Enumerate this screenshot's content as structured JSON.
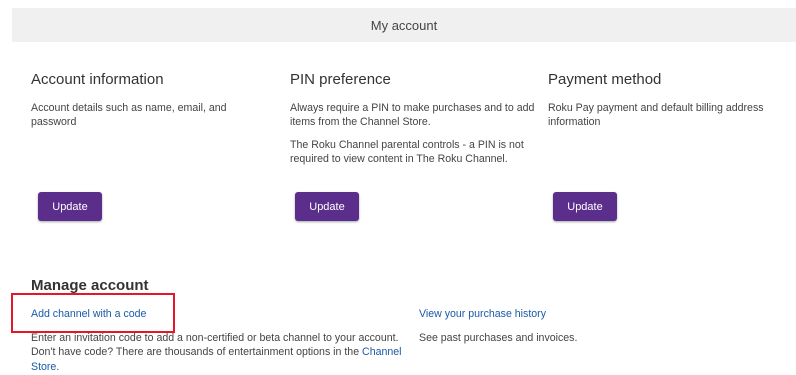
{
  "header": {
    "title": "My account"
  },
  "sections": [
    {
      "title": "Account information",
      "descriptions": [
        "Account details such as name, email, and password"
      ],
      "button_label": "Update"
    },
    {
      "title": "PIN preference",
      "descriptions": [
        "Always require a PIN to make purchases and to add items from the Channel Store.",
        "The Roku Channel parental controls - a PIN is not required to view content in The Roku Channel."
      ],
      "button_label": "Update"
    },
    {
      "title": "Payment method",
      "descriptions": [
        "Roku Pay payment and default billing address information"
      ],
      "button_label": "Update"
    }
  ],
  "manage": {
    "title": "Manage account",
    "add_channel_link": "Add channel with a code",
    "add_channel_desc_prefix": "Enter an invitation code to add a non-certified or beta channel to your account. Don't have code? There are thousands of entertainment options in the ",
    "channel_store_link": "Channel Store",
    "add_channel_desc_suffix": ".",
    "purchase_history_link": "View your purchase history",
    "purchase_history_desc": "See past purchases and invoices."
  },
  "colors": {
    "button_bg": "#5c2e8c",
    "link": "#1a5aa8",
    "highlight": "#e5162a",
    "header_bg": "#f0f0f0"
  }
}
